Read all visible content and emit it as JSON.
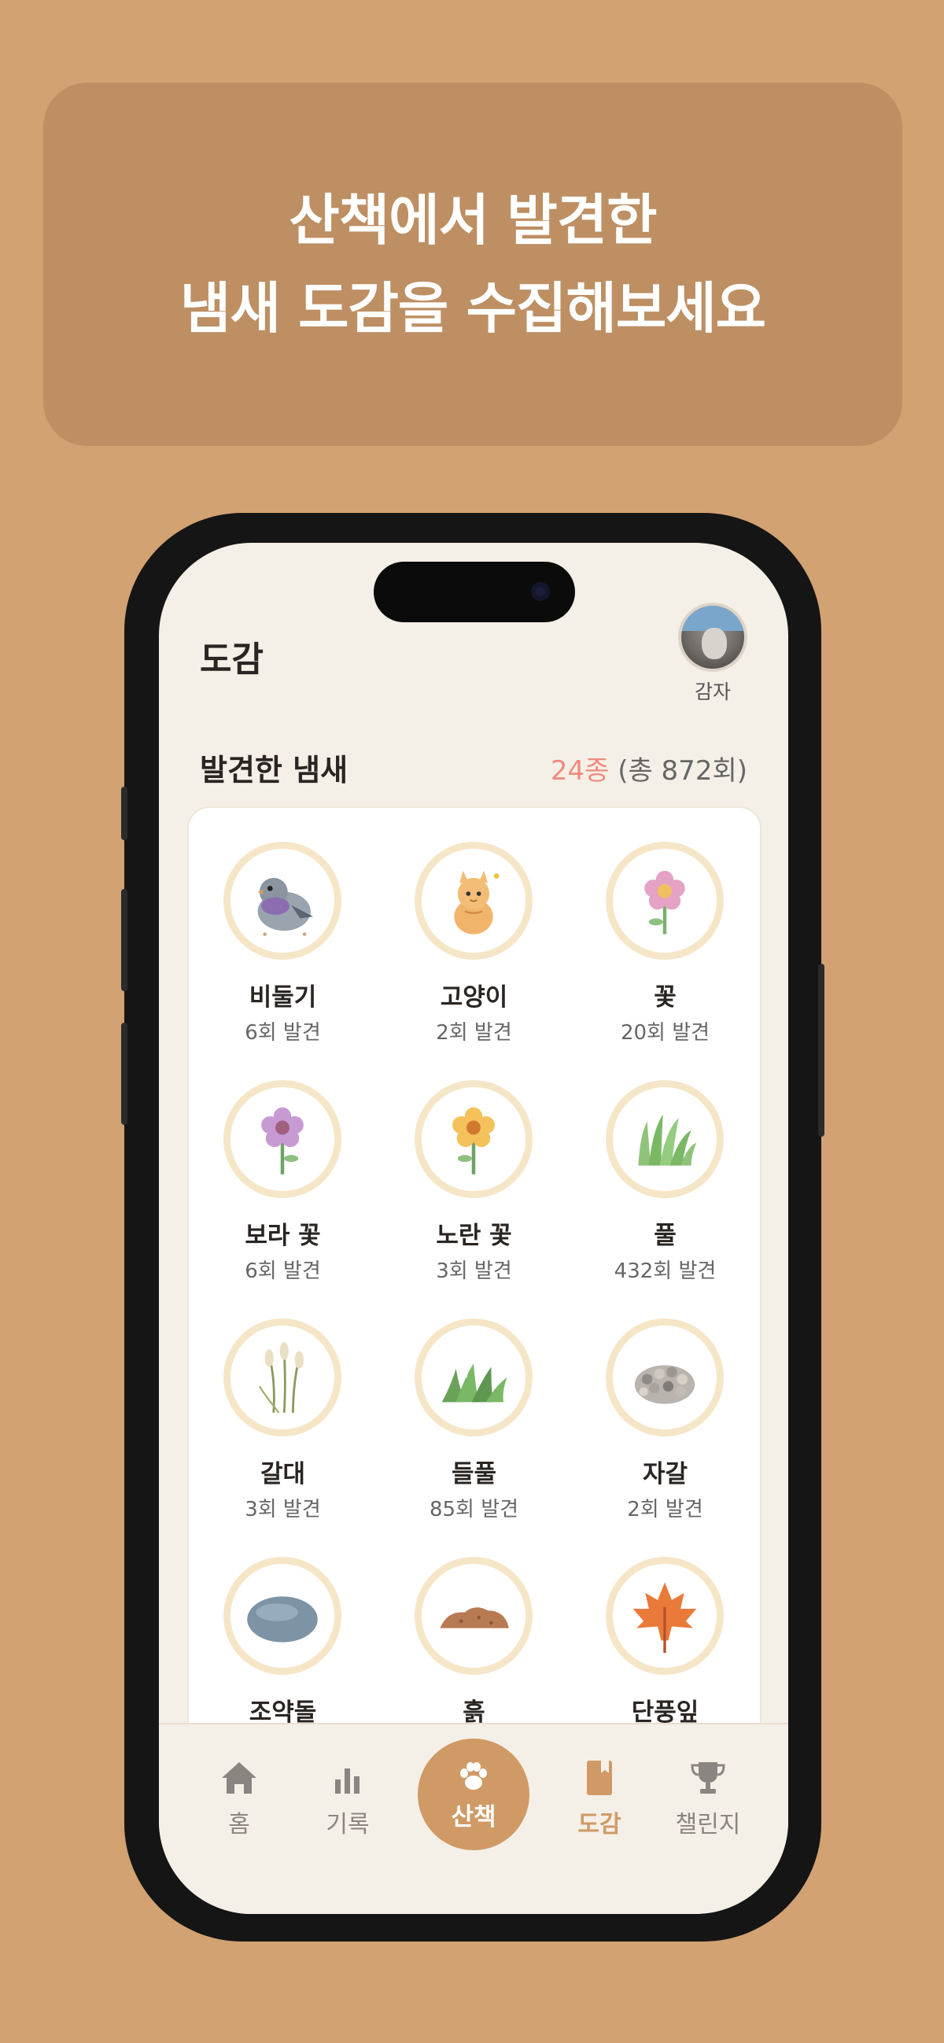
{
  "banner": {
    "line1": "산책에서 발견한",
    "line2": "냄새 도감을 수집해보세요"
  },
  "header": {
    "title": "도감",
    "profile_name": "감자"
  },
  "section": {
    "title": "발견한 냄새",
    "species_count": "24종",
    "total_count": "(총 872회)"
  },
  "items": [
    {
      "name": "비둘기",
      "count": "6회 발견",
      "icon": "pigeon-icon"
    },
    {
      "name": "고양이",
      "count": "2회 발견",
      "icon": "cat-icon"
    },
    {
      "name": "꽃",
      "count": "20회 발견",
      "icon": "pink-flower-icon"
    },
    {
      "name": "보라 꽃",
      "count": "6회 발견",
      "icon": "purple-flower-icon"
    },
    {
      "name": "노란 꽃",
      "count": "3회 발견",
      "icon": "yellow-flower-icon"
    },
    {
      "name": "풀",
      "count": "432회 발견",
      "icon": "grass-icon"
    },
    {
      "name": "갈대",
      "count": "3회 발견",
      "icon": "reed-icon"
    },
    {
      "name": "들풀",
      "count": "85회 발견",
      "icon": "wild-grass-icon"
    },
    {
      "name": "자갈",
      "count": "2회 발견",
      "icon": "gravel-icon"
    },
    {
      "name": "조약돌",
      "count": "",
      "icon": "pebble-icon"
    },
    {
      "name": "흙",
      "count": "",
      "icon": "soil-icon"
    },
    {
      "name": "단풍잎",
      "count": "",
      "icon": "maple-leaf-icon"
    }
  ],
  "tabs": {
    "home": "홈",
    "records": "기록",
    "walk": "산책",
    "collection": "도감",
    "challenge": "챌린지"
  },
  "colors": {
    "background": "#D2A273",
    "banner": "#BD8F63",
    "screen": "#F5F0E7",
    "accent": "#D09A66",
    "count_accent": "#F08A7E",
    "ring": "#F6E6C8"
  }
}
